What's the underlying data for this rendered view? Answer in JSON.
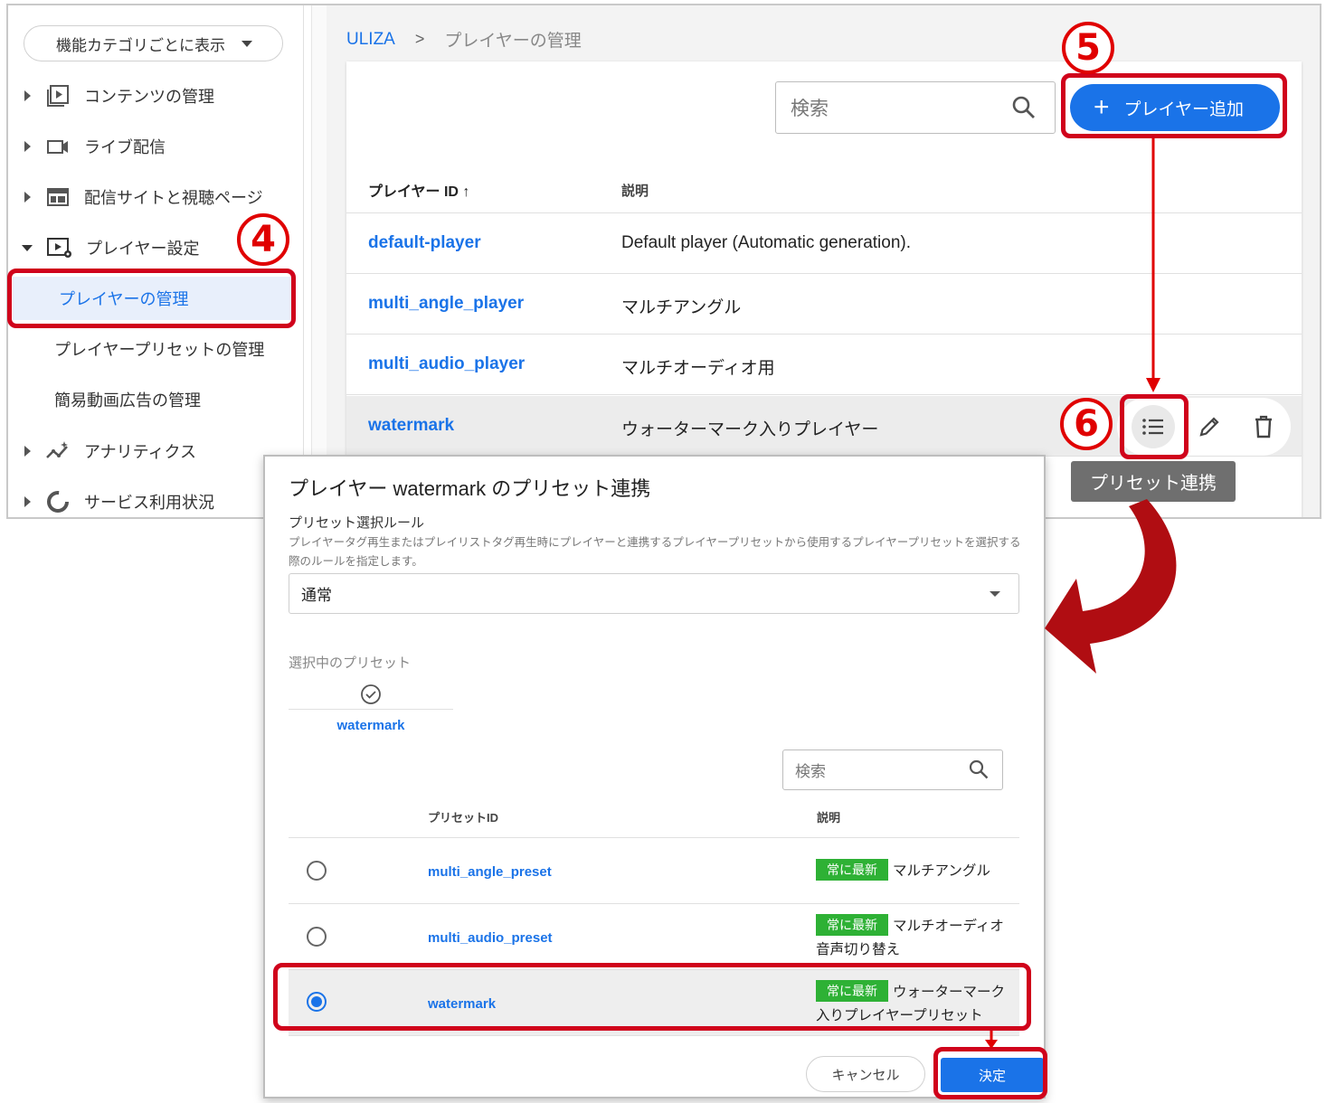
{
  "sidebar": {
    "category_select": "機能カテゴリごとに表示",
    "items": [
      {
        "label": "コンテンツの管理",
        "icon": "video-library-icon"
      },
      {
        "label": "ライブ配信",
        "icon": "videocam-icon"
      },
      {
        "label": "配信サイトと視聴ページ",
        "icon": "web-layout-icon"
      },
      {
        "label": "プレイヤー設定",
        "icon": "player-settings-icon"
      },
      {
        "label": "アナリティクス",
        "icon": "analytics-icon"
      },
      {
        "label": "サービス利用状況",
        "icon": "donut-chart-icon"
      }
    ],
    "sub_items": [
      {
        "label": "プレイヤーの管理",
        "active": true
      },
      {
        "label": "プレイヤープリセットの管理",
        "active": false
      },
      {
        "label": "簡易動画広告の管理",
        "active": false
      }
    ]
  },
  "breadcrumb": {
    "root": "ULIZA",
    "separator": ">",
    "current": "プレイヤーの管理"
  },
  "toolbar": {
    "search_placeholder": "検索",
    "add_label": "プレイヤー追加"
  },
  "table": {
    "columns": [
      "プレイヤー ID ↑",
      "説明"
    ],
    "rows": [
      {
        "id": "default-player",
        "desc": "Default player (Automatic generation)."
      },
      {
        "id": "multi_angle_player",
        "desc": "マルチアングル"
      },
      {
        "id": "multi_audio_player",
        "desc": "マルチオーディオ用"
      },
      {
        "id": "watermark",
        "desc": "ウォーターマーク入りプレイヤー"
      }
    ]
  },
  "tooltip": "プリセット連携",
  "annotations": {
    "step4": "4",
    "step5": "5",
    "step6": "6",
    "color": "#d0021b"
  },
  "dialog": {
    "title": "プレイヤー watermark のプリセット連携",
    "rule_section": "プリセット選択ルール",
    "rule_desc": "プレイヤータグ再生またはプレイリストタグ再生時にプレイヤーと連携するプレイヤープリセットから使用するプレイヤープリセットを選択する際のルールを指定します。",
    "rule_value": "通常",
    "selected_label": "選択中のプリセット",
    "selected_preset": "watermark",
    "search_placeholder": "検索",
    "columns": [
      "プリセットID",
      "説明"
    ],
    "badge": "常に最新",
    "presets": [
      {
        "id": "multi_angle_preset",
        "desc": "マルチアングル",
        "selected": false
      },
      {
        "id": "multi_audio_preset",
        "desc": "マルチオーディオ音声切り替え",
        "selected": false
      },
      {
        "id": "watermark",
        "desc": "ウォーターマーク入りプレイヤープリセット",
        "selected": true
      }
    ],
    "cancel_label": "キャンセル",
    "ok_label": "決定"
  },
  "colors": {
    "accent": "#1a73e8",
    "badge": "#2eb135",
    "annotation_red": "#d0021b"
  }
}
